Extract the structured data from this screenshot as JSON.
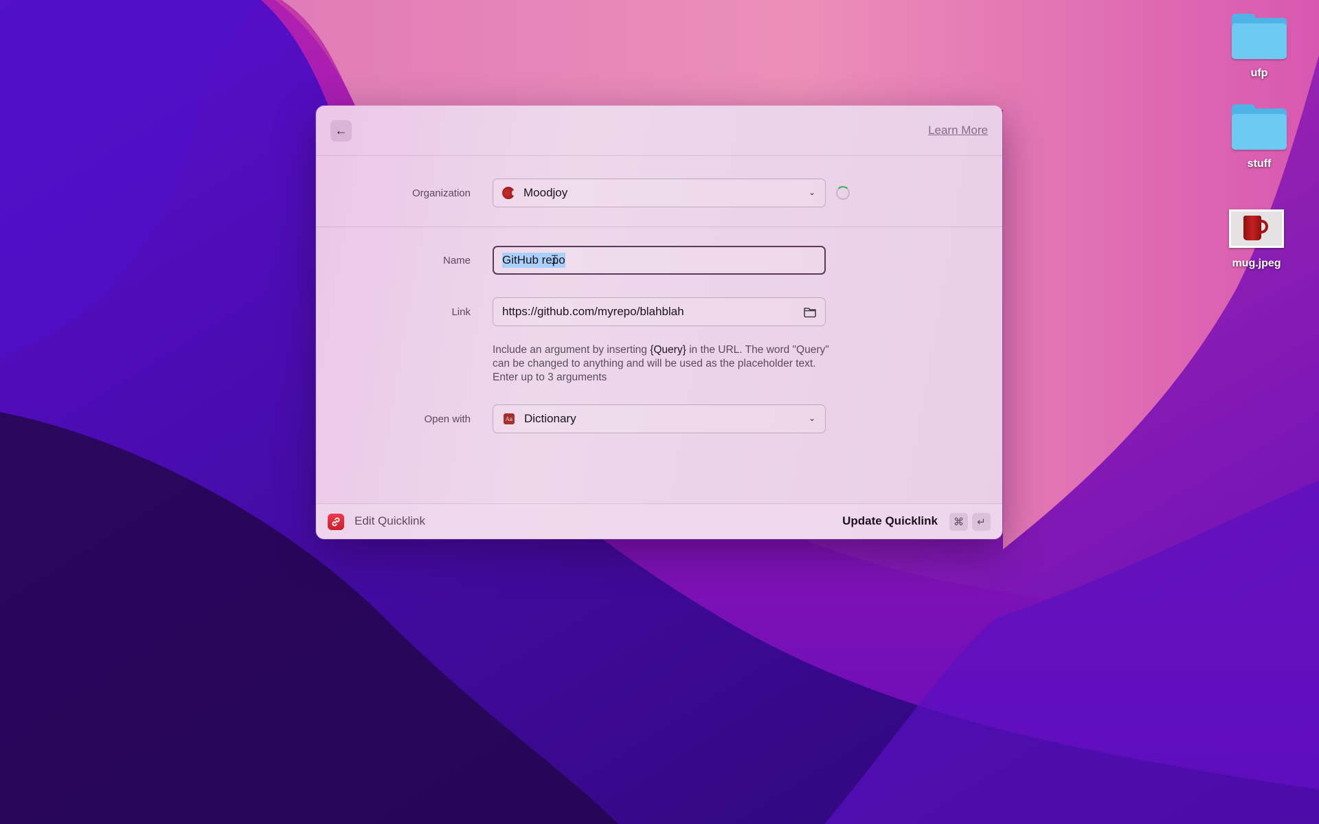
{
  "desktop": {
    "icons": [
      {
        "type": "folder",
        "label": "ufp"
      },
      {
        "type": "folder",
        "label": "stuff"
      },
      {
        "type": "image",
        "label": "mug.jpeg"
      }
    ]
  },
  "window": {
    "header": {
      "back_icon": "arrow-left",
      "learn_more": "Learn More"
    },
    "form": {
      "organization": {
        "label": "Organization",
        "value": "Moodjoy",
        "loading": true
      },
      "name": {
        "label": "Name",
        "value": "GitHub repo",
        "selected": true
      },
      "link": {
        "label": "Link",
        "value": "https://github.com/myrepo/blahblah",
        "icon": "folder"
      },
      "help": {
        "before": "Include an argument by inserting ",
        "token": "{Query}",
        "after": " in the URL. The word \"Query\" can be changed to anything and will be used as the placeholder text. Enter up to 3 arguments"
      },
      "open_with": {
        "label": "Open with",
        "value": "Dictionary",
        "icon_text": "Aa"
      }
    },
    "footer": {
      "title": "Edit Quicklink",
      "action": "Update Quicklink",
      "shortcut": [
        "⌘",
        "↵"
      ]
    }
  },
  "colors": {
    "accent_red": "#e0303e",
    "selection": "#a8d0f8",
    "spinner_accent": "#2bb352"
  }
}
